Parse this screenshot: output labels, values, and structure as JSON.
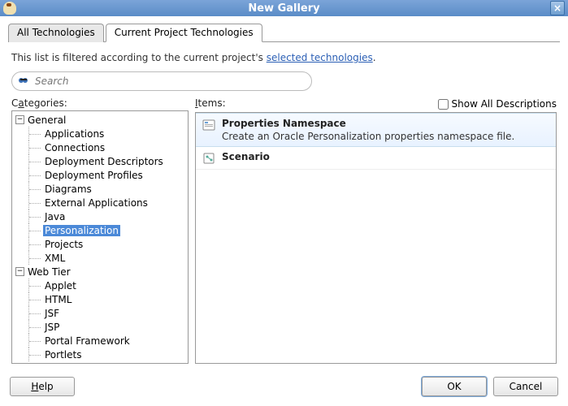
{
  "window": {
    "title": "New Gallery",
    "close_icon": "×"
  },
  "tabs": {
    "all": "All Technologies",
    "current": "Current Project Technologies"
  },
  "filter_text": {
    "prefix": "This list is filtered according to the current project's ",
    "link": "selected technologies",
    "suffix": "."
  },
  "search": {
    "placeholder": "Search"
  },
  "panes": {
    "categories_label_pre": "C",
    "categories_label_ul": "a",
    "categories_label_post": "tegories:",
    "items_label_pre": "",
    "items_label_ul": "I",
    "items_label_post": "tems:",
    "show_all_pre": "Show All ",
    "show_all_ul": "D",
    "show_all_post": "escriptions"
  },
  "tree": {
    "general": "General",
    "general_children": [
      "Applications",
      "Connections",
      "Deployment Descriptors",
      "Deployment Profiles",
      "Diagrams",
      "External Applications",
      "Java",
      "Personalization",
      "Projects",
      "XML"
    ],
    "web_tier": "Web Tier",
    "web_tier_children": [
      "Applet",
      "HTML",
      "JSF",
      "JSP",
      "Portal Framework",
      "Portlets"
    ]
  },
  "items": [
    {
      "title": "Properties Namespace",
      "desc": "Create an Oracle Personalization properties namespace file.",
      "icon": "props",
      "selected": true
    },
    {
      "title": "Scenario",
      "desc": "",
      "icon": "scenario",
      "selected": false
    }
  ],
  "buttons": {
    "help_ul": "H",
    "help_post": "elp",
    "ok": "OK",
    "cancel": "Cancel"
  }
}
